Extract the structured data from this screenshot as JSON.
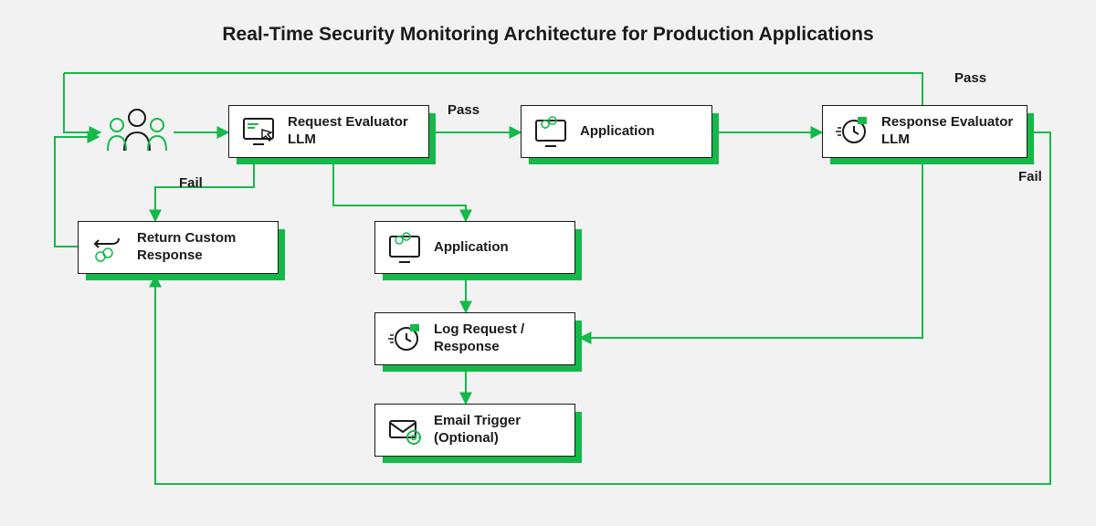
{
  "title": "Real-Time Security Monitoring Architecture for Production Applications",
  "nodes": {
    "users": {
      "icon": "users"
    },
    "reqEval": {
      "label": "Request Evaluator LLM"
    },
    "appTop": {
      "label": "Application"
    },
    "respEval": {
      "label": "Response Evaluator LLM"
    },
    "returnCustom": {
      "label": "Return Custom Response"
    },
    "appMid": {
      "label": "Application"
    },
    "logReq": {
      "label": "Log Request / Response"
    },
    "emailTrig": {
      "label": "Email Trigger (Optional)"
    }
  },
  "edgeLabels": {
    "passTop": "Pass",
    "passRight": "Pass",
    "failLeft": "Fail",
    "failRight": "Fail"
  }
}
